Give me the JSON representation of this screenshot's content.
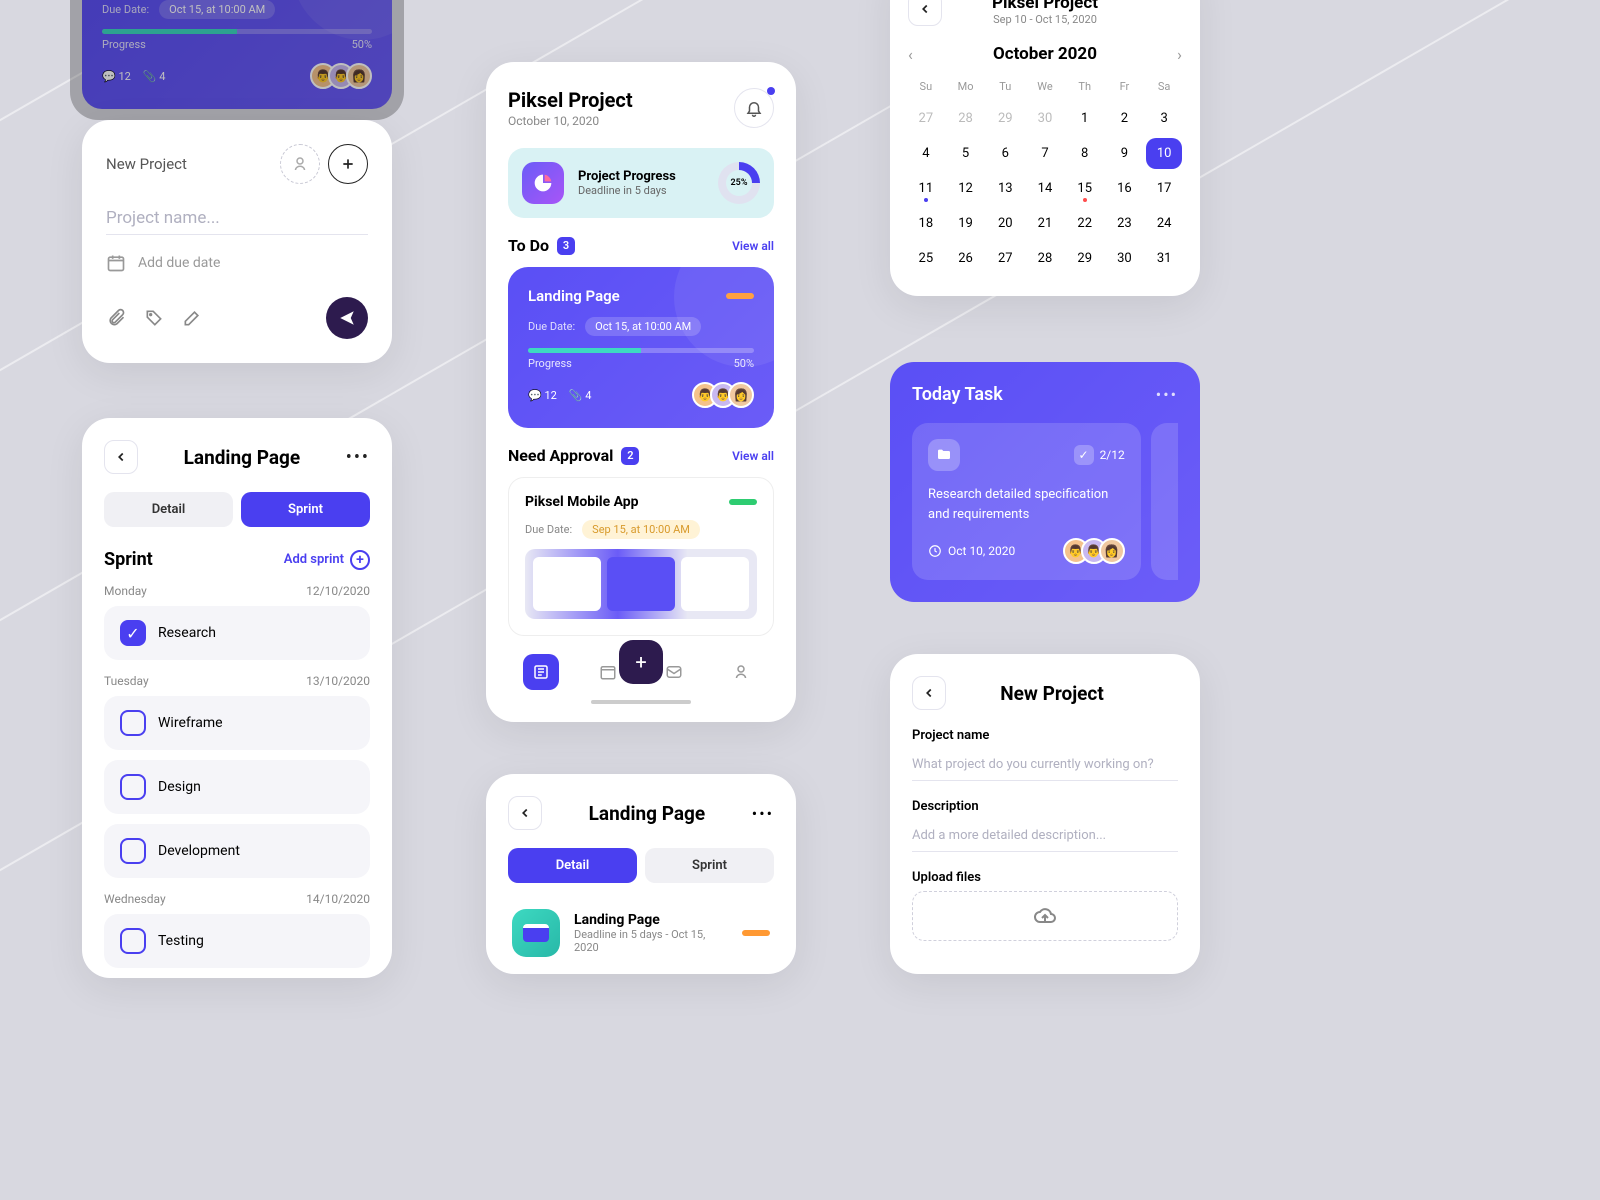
{
  "colors": {
    "accent": "#4a3ff0",
    "teal": "#3dd9c1",
    "orange": "#ff9933",
    "green": "#2ecc71",
    "dark": "#2d1b4e",
    "red": "#ff4d4d"
  },
  "newProjectMini": {
    "title": "New Project",
    "placeholder": "Project name...",
    "addDue": "Add due date"
  },
  "sprint": {
    "title": "Landing Page",
    "tabs": {
      "detail": "Detail",
      "sprint": "Sprint"
    },
    "heading": "Sprint",
    "addSprint": "Add sprint",
    "days": [
      {
        "name": "Monday",
        "date": "12/10/2020",
        "items": [
          {
            "label": "Research",
            "checked": true
          }
        ]
      },
      {
        "name": "Tuesday",
        "date": "13/10/2020",
        "items": [
          {
            "label": "Wireframe",
            "checked": false
          },
          {
            "label": "Design",
            "checked": false
          },
          {
            "label": "Development",
            "checked": false
          }
        ]
      },
      {
        "name": "Wednesday",
        "date": "14/10/2020",
        "items": [
          {
            "label": "Testing",
            "checked": false
          }
        ]
      }
    ]
  },
  "dashboard": {
    "title": "Piksel Project",
    "date": "October 10, 2020",
    "progressCard": {
      "title": "Project Progress",
      "subtitle": "Deadline in 5 days",
      "percent": "25%"
    },
    "todo": {
      "title": "To Do",
      "count": "3",
      "viewAll": "View all"
    },
    "landingTask": {
      "title": "Landing Page",
      "dueLabel": "Due Date:",
      "dueValue": "Oct 15, at 10:00 AM",
      "progressLabel": "Progress",
      "progressValue": "50%",
      "comments": "12",
      "attachments": "4"
    },
    "approval": {
      "title": "Need Approval",
      "count": "2",
      "viewAll": "View all"
    },
    "approvalTask": {
      "title": "Piksel Mobile App",
      "dueLabel": "Due Date:",
      "dueValue": "Sep 15, at 10:00 AM"
    }
  },
  "detailPanel": {
    "title": "Landing Page",
    "tabs": {
      "detail": "Detail",
      "sprint": "Sprint"
    },
    "card": {
      "title": "Landing Page",
      "subtitle": "Deadline in 5 days - Oct 15, 2020"
    }
  },
  "calendar": {
    "title": "Piksel Project",
    "range": "Sep 10 - Oct 15, 2020",
    "month": "October 2020",
    "dayNames": [
      "Su",
      "Mo",
      "Tu",
      "We",
      "Th",
      "Fr",
      "Sa"
    ],
    "prevMonth": [
      27,
      28,
      29,
      30
    ],
    "days": [
      1,
      2,
      3,
      4,
      5,
      6,
      7,
      8,
      9,
      10,
      11,
      12,
      13,
      14,
      15,
      16,
      17,
      18,
      19,
      20,
      21,
      22,
      23,
      24,
      25,
      26,
      27,
      28,
      29,
      30,
      31
    ],
    "selected": 10,
    "dots": {
      "11": "#4a3ff0",
      "15": "#ff4d4d"
    }
  },
  "todayTask": {
    "title": "Today Task",
    "card": {
      "count": "2/12",
      "desc": "Research detailed specification and requirements",
      "date": "Oct 10, 2020"
    }
  },
  "newProjectFull": {
    "title": "New Project",
    "nameLabel": "Project name",
    "namePlaceholder": "What project do you currently working on?",
    "descLabel": "Description",
    "descPlaceholder": "Add a more detailed description...",
    "uploadLabel": "Upload files"
  },
  "topCard": {
    "dueLabel": "Due Date:",
    "dueValue": "Oct 15, at 10:00 AM",
    "progressLabel": "Progress",
    "progressValue": "50%",
    "comments": "12",
    "attachments": "4"
  }
}
